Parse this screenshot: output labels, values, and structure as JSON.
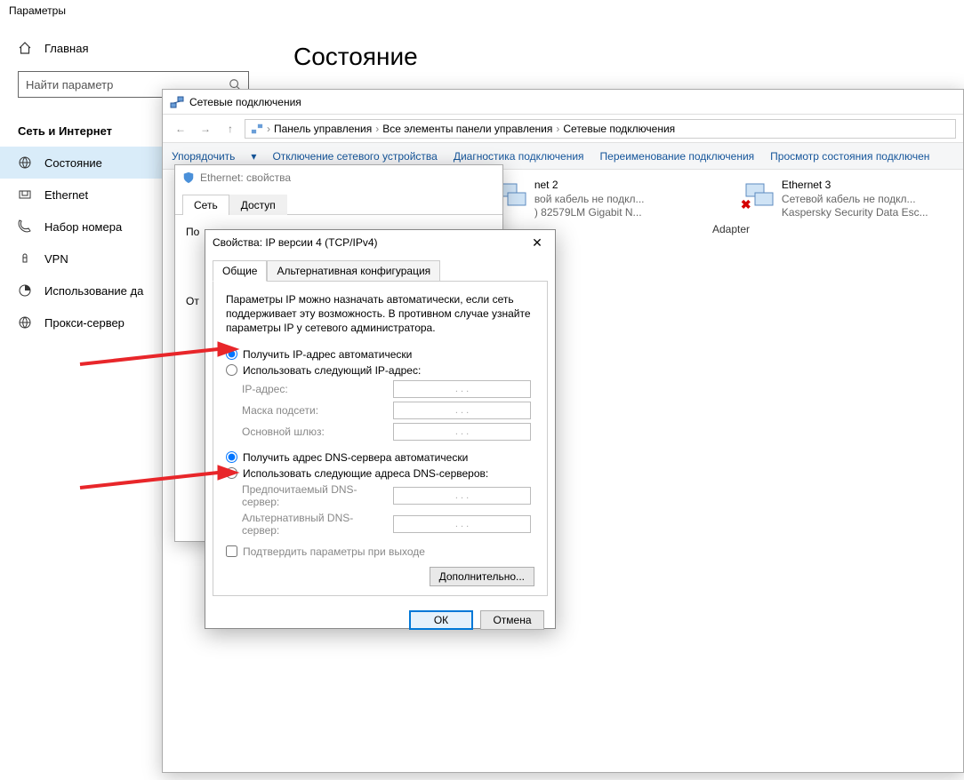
{
  "settings": {
    "title": "Параметры",
    "home": "Главная",
    "search_placeholder": "Найти параметр",
    "category": "Сеть и Интернет",
    "nav": {
      "status": "Состояние",
      "ethernet": "Ethernet",
      "dialup": "Набор номера",
      "vpn": "VPN",
      "data_usage": "Использование да",
      "proxy": "Прокси-сервер"
    },
    "main_heading": "Состояние"
  },
  "explorer": {
    "title": "Сетевые подключения",
    "breadcrumb": {
      "cp": "Панель управления",
      "all": "Все элементы панели управления",
      "net": "Сетевые подключения"
    },
    "toolbar": {
      "organize": "Упорядочить",
      "disable": "Отключение сетевого устройства",
      "diagnose": "Диагностика подключения",
      "rename": "Переименование подключения",
      "view_status": "Просмотр состояния подключен"
    },
    "adapters": {
      "eth2": {
        "name": "net 2",
        "sub1": "вой кабель не подкл...",
        "sub2": ") 82579LM Gigabit N..."
      },
      "eth3": {
        "name": "Ethernet 3",
        "sub1": "Сетевой кабель не подкл...",
        "sub2": "Kaspersky Security Data Esc..."
      }
    }
  },
  "ethprops": {
    "title": "Ethernet: свойства",
    "tabs": {
      "net": "Сеть",
      "access": "Доступ"
    },
    "body": {
      "connect_label": "По",
      "desc_label": "От",
      "adapter_suffix": "Adapter"
    }
  },
  "ipv4": {
    "title": "Свойства: IP версии 4 (TCP/IPv4)",
    "tabs": {
      "general": "Общие",
      "alt": "Альтернативная конфигурация"
    },
    "desc": "Параметры IP можно назначать автоматически, если сеть поддерживает эту возможность. В противном случае узнайте параметры IP у сетевого администратора.",
    "ip": {
      "auto": "Получить IP-адрес автоматически",
      "manual": "Использовать следующий IP-адрес:",
      "addr": "IP-адрес:",
      "mask": "Маска подсети:",
      "gw": "Основной шлюз:"
    },
    "dns": {
      "auto": "Получить адрес DNS-сервера автоматически",
      "manual": "Использовать следующие адреса DNS-серверов:",
      "pref": "Предпочитаемый DNS-сервер:",
      "alt": "Альтернативный DNS-сервер:"
    },
    "validate": "Подтвердить параметры при выходе",
    "advanced": "Дополнительно...",
    "ok": "ОК",
    "cancel": "Отмена",
    "dotsep": ".        .        ."
  }
}
